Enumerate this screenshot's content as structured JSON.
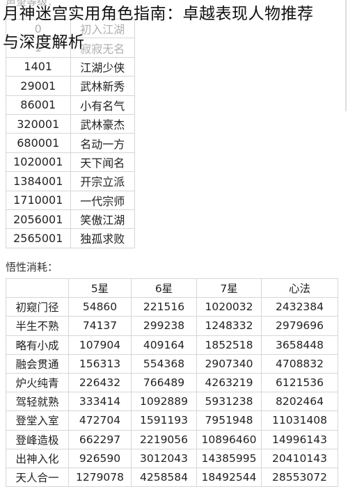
{
  "title": {
    "line1": "月神迷宫实用角色指南：卓越表现人物推荐",
    "line2": "与深度解析"
  },
  "reputation": {
    "label": "声望等级：",
    "rows": [
      [
        "0",
        "初入江湖"
      ],
      [
        "1",
        "寂寂无名"
      ],
      [
        "1401",
        "江湖少侠"
      ],
      [
        "29001",
        "武林新秀"
      ],
      [
        "86001",
        "小有名气"
      ],
      [
        "320001",
        "武林豪杰"
      ],
      [
        "680001",
        "名动一方"
      ],
      [
        "1020001",
        "天下闻名"
      ],
      [
        "1384001",
        "开宗立派"
      ],
      [
        "1710001",
        "一代宗师"
      ],
      [
        "2056001",
        "笑傲江湖"
      ],
      [
        "2565001",
        "独孤求败"
      ]
    ]
  },
  "wisdom": {
    "label": "悟性消耗：",
    "headers": [
      "",
      "5星",
      "6星",
      "7星",
      "心法"
    ],
    "rows": [
      [
        "初窥门径",
        "54860",
        "221516",
        "1020032",
        "2432384"
      ],
      [
        "半生不熟",
        "74137",
        "299238",
        "1248332",
        "2979696"
      ],
      [
        "略有小成",
        "107904",
        "409164",
        "1852518",
        "3658448"
      ],
      [
        "融会贯通",
        "156313",
        "554368",
        "2907340",
        "4708832"
      ],
      [
        "炉火纯青",
        "226432",
        "766489",
        "4263219",
        "6121536"
      ],
      [
        "驾轻就熟",
        "333414",
        "1092889",
        "5931238",
        "8202464"
      ],
      [
        "登堂入室",
        "472704",
        "1591193",
        "7951948",
        "11031408"
      ],
      [
        "登峰造极",
        "662297",
        "2219056",
        "10896460",
        "14996143"
      ],
      [
        "出神入化",
        "926590",
        "3012043",
        "14385995",
        "20410143"
      ],
      [
        "天人合一",
        "1279078",
        "4258584",
        "18492544",
        "28553072"
      ]
    ]
  }
}
